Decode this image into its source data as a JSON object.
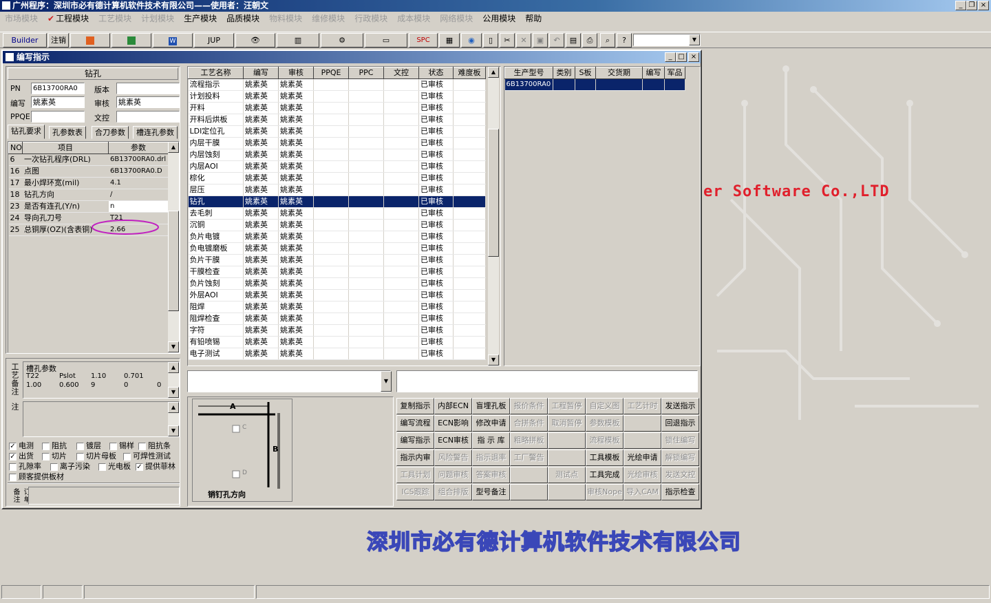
{
  "app": {
    "title": "广州程序：深圳市必有德计算机软件技术有限公司——使用者：汪朝文"
  },
  "menu": [
    {
      "label": "市场模块",
      "disabled": true
    },
    {
      "label": "工程模块",
      "disabled": false,
      "checked": true
    },
    {
      "label": "工艺模块",
      "disabled": true
    },
    {
      "label": "计划模块",
      "disabled": true
    },
    {
      "label": "生产模块",
      "disabled": false
    },
    {
      "label": "品质模块",
      "disabled": false
    },
    {
      "label": "物料模块",
      "disabled": true
    },
    {
      "label": "维修模块",
      "disabled": true
    },
    {
      "label": "行政模块",
      "disabled": true
    },
    {
      "label": "成本模块",
      "disabled": true
    },
    {
      "label": "网络模块",
      "disabled": true
    },
    {
      "label": "公用模块",
      "disabled": false
    },
    {
      "label": "帮助",
      "disabled": false
    }
  ],
  "toolbar": {
    "builder": "Builder",
    "logout": "注销",
    "jup": "JUP",
    "spc": "SPC"
  },
  "window": {
    "title": "编写指示"
  },
  "left": {
    "process_name": "钻孔",
    "pn_label": "PN",
    "pn_value": "6B13700RA0",
    "version_label": "版本",
    "version_value": "",
    "author_label": "编写",
    "author_value": "姚素英",
    "review_label": "审核",
    "review_value": "姚素英",
    "ppqe_label": "PPQE",
    "ppqe_value": "",
    "control_label": "文控",
    "control_value": "",
    "tabs": [
      "钻孔要求",
      "孔参数表",
      "合刀参数",
      "槽连孔参数"
    ],
    "param_headers": {
      "no": "NO",
      "item": "项目",
      "param": "参数"
    },
    "params": [
      {
        "no": "6",
        "item": "一次钻孔程序(DRL)",
        "value": "6B13700RA0.drl"
      },
      {
        "no": "16",
        "item": "点图",
        "value": "6B13700RA0.D"
      },
      {
        "no": "17",
        "item": "最小焊环宽(mil)",
        "value": "4.1"
      },
      {
        "no": "18",
        "item": "钻孔方向",
        "value": "/"
      },
      {
        "no": "23",
        "item": "是否有连孔(Y/n)",
        "value": "n"
      },
      {
        "no": "24",
        "item": "导向孔刀号",
        "value": "T21"
      },
      {
        "no": "25",
        "item": "总铜厚(OZ)(含表铜)",
        "value": "2.66"
      }
    ],
    "slot_title": "槽孔参数",
    "slot_row1": [
      "T22",
      "Pslot",
      "1.10",
      "0.701"
    ],
    "slot_row2": [
      "1.00",
      "0.600",
      "9",
      "0",
      "0"
    ],
    "side_label1": "工艺备注",
    "side_label2": "型号备注",
    "side_label3": "订单备注",
    "checks": [
      {
        "label": "电测",
        "checked": true
      },
      {
        "label": "阻抗",
        "checked": false
      },
      {
        "label": "镀层",
        "checked": false
      },
      {
        "label": "锡样",
        "checked": false
      },
      {
        "label": "阻抗条",
        "checked": false
      },
      {
        "label": "出货",
        "checked": true
      },
      {
        "label": "切片",
        "checked": false
      },
      {
        "label": "切片母板",
        "checked": false
      },
      {
        "label": "可焊性测试",
        "checked": false
      },
      {
        "label": "孔隙率",
        "checked": false
      },
      {
        "label": "离子污染",
        "checked": false
      },
      {
        "label": "光电板",
        "checked": false
      },
      {
        "label": "提供菲林",
        "checked": true
      },
      {
        "label": "顾客提供板材",
        "checked": false
      }
    ]
  },
  "process_table": {
    "headers": [
      "工艺名称",
      "编写",
      "审核",
      "PPQE",
      "PPC",
      "文控",
      "状态",
      "难度板"
    ],
    "rows": [
      [
        "流程指示",
        "姚素英",
        "姚素英",
        "",
        "",
        "",
        "已审核",
        ""
      ],
      [
        "计划投料",
        "姚素英",
        "姚素英",
        "",
        "",
        "",
        "已审核",
        ""
      ],
      [
        "开料",
        "姚素英",
        "姚素英",
        "",
        "",
        "",
        "已审核",
        ""
      ],
      [
        "开料后烘板",
        "姚素英",
        "姚素英",
        "",
        "",
        "",
        "已审核",
        ""
      ],
      [
        "LDI定位孔",
        "姚素英",
        "姚素英",
        "",
        "",
        "",
        "已审核",
        ""
      ],
      [
        "内层干膜",
        "姚素英",
        "姚素英",
        "",
        "",
        "",
        "已审核",
        ""
      ],
      [
        "内层蚀刻",
        "姚素英",
        "姚素英",
        "",
        "",
        "",
        "已审核",
        ""
      ],
      [
        "内层AOI",
        "姚素英",
        "姚素英",
        "",
        "",
        "",
        "已审核",
        ""
      ],
      [
        "棕化",
        "姚素英",
        "姚素英",
        "",
        "",
        "",
        "已审核",
        ""
      ],
      [
        "层压",
        "姚素英",
        "姚素英",
        "",
        "",
        "",
        "已审核",
        ""
      ],
      [
        "钻孔",
        "姚素英",
        "姚素英",
        "",
        "",
        "",
        "已审核",
        ""
      ],
      [
        "去毛刺",
        "姚素英",
        "姚素英",
        "",
        "",
        "",
        "已审核",
        ""
      ],
      [
        "沉铜",
        "姚素英",
        "姚素英",
        "",
        "",
        "",
        "已审核",
        ""
      ],
      [
        "负片电镀",
        "姚素英",
        "姚素英",
        "",
        "",
        "",
        "已审核",
        ""
      ],
      [
        "负电镀磨板",
        "姚素英",
        "姚素英",
        "",
        "",
        "",
        "已审核",
        ""
      ],
      [
        "负片干膜",
        "姚素英",
        "姚素英",
        "",
        "",
        "",
        "已审核",
        ""
      ],
      [
        "干膜检查",
        "姚素英",
        "姚素英",
        "",
        "",
        "",
        "已审核",
        ""
      ],
      [
        "负片蚀刻",
        "姚素英",
        "姚素英",
        "",
        "",
        "",
        "已审核",
        ""
      ],
      [
        "外层AOI",
        "姚素英",
        "姚素英",
        "",
        "",
        "",
        "已审核",
        ""
      ],
      [
        "阻焊",
        "姚素英",
        "姚素英",
        "",
        "",
        "",
        "已审核",
        ""
      ],
      [
        "阻焊检查",
        "姚素英",
        "姚素英",
        "",
        "",
        "",
        "已审核",
        ""
      ],
      [
        "字符",
        "姚素英",
        "姚素英",
        "",
        "",
        "",
        "已审核",
        ""
      ],
      [
        "有铅喷锡",
        "姚素英",
        "姚素英",
        "",
        "",
        "",
        "已审核",
        ""
      ],
      [
        "电子测试",
        "姚素英",
        "姚素英",
        "",
        "",
        "",
        "已审核",
        ""
      ]
    ],
    "selected_index": 10
  },
  "model_table": {
    "headers": [
      "生产型号",
      "类别",
      "S板",
      "交货期",
      "编写",
      "军品"
    ],
    "rows": [
      [
        "6B13700RA0",
        "",
        "",
        "",
        "",
        ""
      ]
    ]
  },
  "diagram": {
    "a": "A",
    "b": "B",
    "c": "C",
    "d": "D",
    "caption": "销钉孔方向"
  },
  "actions": [
    [
      "复制指示",
      "内部ECN",
      "盲埋孔板",
      "报价条件",
      "工程暂停",
      "自定义图",
      "工艺计时",
      "发送指示"
    ],
    [
      "编写流程",
      "ECN影响",
      "修改申请",
      "合拼条件",
      "取消暂停",
      "参数模板",
      "",
      "回退指示"
    ],
    [
      "编写指示",
      "ECN审核",
      "指 示 库",
      "粗略拼板",
      "",
      "流程模板",
      "",
      "锁住编写"
    ],
    [
      "指示内审",
      "风险警告",
      "指示退率",
      "工厂警告",
      "",
      "工具模板",
      "光绘申请",
      "解锁编写"
    ],
    [
      "工具计划",
      "问题审核",
      "答案审核",
      "",
      "测试点",
      "工具完成",
      "光绘审核",
      "发送文控"
    ],
    [
      "ICS跟踪",
      "组合排版",
      "型号备注",
      "",
      "",
      "审核Nope",
      "导入CAM",
      "指示检查"
    ]
  ],
  "actions_disabled": [
    [
      false,
      false,
      false,
      true,
      true,
      true,
      true,
      false
    ],
    [
      false,
      false,
      false,
      true,
      true,
      true,
      false,
      false
    ],
    [
      false,
      false,
      false,
      true,
      false,
      true,
      false,
      true
    ],
    [
      false,
      true,
      true,
      true,
      false,
      false,
      false,
      true
    ],
    [
      true,
      true,
      true,
      false,
      true,
      false,
      true,
      true
    ],
    [
      true,
      true,
      false,
      false,
      false,
      true,
      true,
      false
    ]
  ],
  "background": {
    "company_cn": "深圳市必有德计算机软件技术有限公司",
    "company_en": "er Software Co.,LTD"
  },
  "colors": {
    "title_start": "#0a246a",
    "title_end": "#a6caf0",
    "selection": "#0a246a",
    "brand_red": "#e0202c",
    "brand_blue": "#3a47b8"
  }
}
